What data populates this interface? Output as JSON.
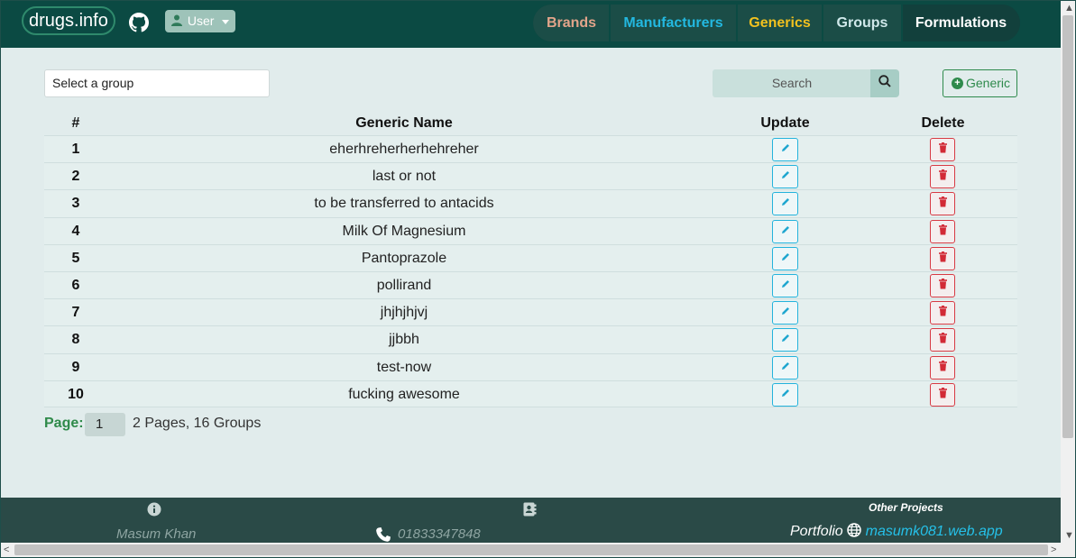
{
  "navbar": {
    "brand": "drugs.info",
    "user_label": "User",
    "links": [
      "Brands",
      "Manufacturers",
      "Generics",
      "Groups",
      "Formulations"
    ],
    "colors": {
      "background": "#0b4a43",
      "brands": "#e2a48a",
      "manufacturers": "#23b8e0",
      "generics": "#f2c11f",
      "groups": "#cfe8ea",
      "formulations": "#ffffff"
    }
  },
  "controls": {
    "group_select_value": "Select a group",
    "search_placeholder": "Search",
    "add_button_label": "Generic"
  },
  "table": {
    "headers": [
      "#",
      "Generic Name",
      "Update",
      "Delete"
    ],
    "rows": [
      {
        "num": "1",
        "name": "eherhreherherhehreher"
      },
      {
        "num": "2",
        "name": "last or not"
      },
      {
        "num": "3",
        "name": "to be transferred to antacids"
      },
      {
        "num": "4",
        "name": "Milk Of Magnesium"
      },
      {
        "num": "5",
        "name": "Pantoprazole"
      },
      {
        "num": "6",
        "name": "pollirand"
      },
      {
        "num": "7",
        "name": "jhjhjhjvj"
      },
      {
        "num": "8",
        "name": "jjbbh"
      },
      {
        "num": "9",
        "name": "test-now"
      },
      {
        "num": "10",
        "name": "fucking awesome"
      }
    ]
  },
  "pagination": {
    "label": "Page:",
    "current_page": "1",
    "info": "2 Pages, 16 Groups"
  },
  "footer": {
    "name": "Masum Khan",
    "phone": "01833347848",
    "other_projects": "Other Projects",
    "portfolio_label": "Portfolio",
    "portfolio_link": "masumk081.web.app"
  },
  "icons": {
    "github": "github-icon",
    "user": "user-icon",
    "search": "search-icon",
    "add": "plus-circle-icon",
    "edit": "pencil-icon",
    "delete": "trash-icon",
    "info": "info-icon",
    "contact": "address-book-icon",
    "phone": "phone-icon",
    "globe": "globe-icon"
  }
}
